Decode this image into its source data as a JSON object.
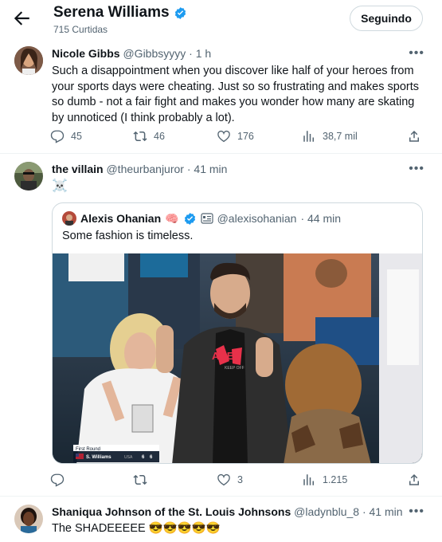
{
  "header": {
    "title": "Serena Williams",
    "subtitle": "715 Curtidas",
    "follow_label": "Seguindo"
  },
  "tweets": [
    {
      "name": "Nicole Gibbs",
      "handle": "@Gibbsyyyy",
      "time": "· 1 h",
      "text": "Such a disappointment when you discover like half of your heroes from your sports days were cheating. Just so so frustrating and makes sports so dumb - not a fair fight and makes you wonder how many are skating by unnoticed (I think probably a lot).",
      "replies": "45",
      "retweets": "46",
      "likes": "176",
      "views": "38,7 mil"
    },
    {
      "name": "the villain",
      "handle": "@theurbanjuror",
      "time": "· 41 min",
      "text": "☠️",
      "quote": {
        "name": "Alexis Ohanian",
        "emoji": "🧠",
        "handle": "@alexisohanian",
        "time": "· 44 min",
        "text": "Some fashion is timeless.",
        "scoreboard": {
          "round": "First Round",
          "player": "S. Williams",
          "country": "USA",
          "score_1": "6",
          "score_2": "6"
        },
        "shirt_text": "ARE",
        "shirt_subtext": "KEEP OFF"
      },
      "replies": "",
      "retweets": "",
      "likes": "3",
      "views": "1.215"
    },
    {
      "name": "Shaniqua Johnson of the St. Louis Johnsons",
      "handle": "@ladynblu_8",
      "time": "· 41 min",
      "text": "The SHADEEEEE 😎😎😎😎😎"
    }
  ],
  "more_label": "•••",
  "colors": {
    "verified": "#1d9bf0",
    "muted": "#536471",
    "border": "#eff3f4"
  },
  "icons": [
    "back-arrow-icon",
    "verified-icon",
    "reply-icon",
    "retweet-icon",
    "like-icon",
    "views-icon",
    "share-icon",
    "more-icon"
  ]
}
